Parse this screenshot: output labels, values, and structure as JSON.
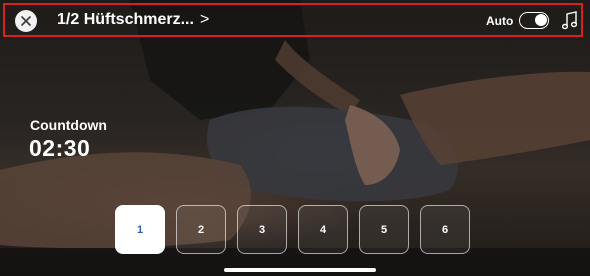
{
  "header": {
    "title": "1/2 Hüftschmerz...",
    "chevron": ">",
    "auto_label": "Auto",
    "auto_toggle_on": true
  },
  "countdown": {
    "label": "Countdown",
    "value": "02:30"
  },
  "steps": {
    "items": [
      "1",
      "2",
      "3",
      "4",
      "5",
      "6"
    ],
    "active": "1"
  },
  "colors": {
    "highlight_border": "#d4231f",
    "active_step_text": "#2e5fa8"
  },
  "icons": {
    "close": "close-icon",
    "music": "music-note-icon"
  }
}
